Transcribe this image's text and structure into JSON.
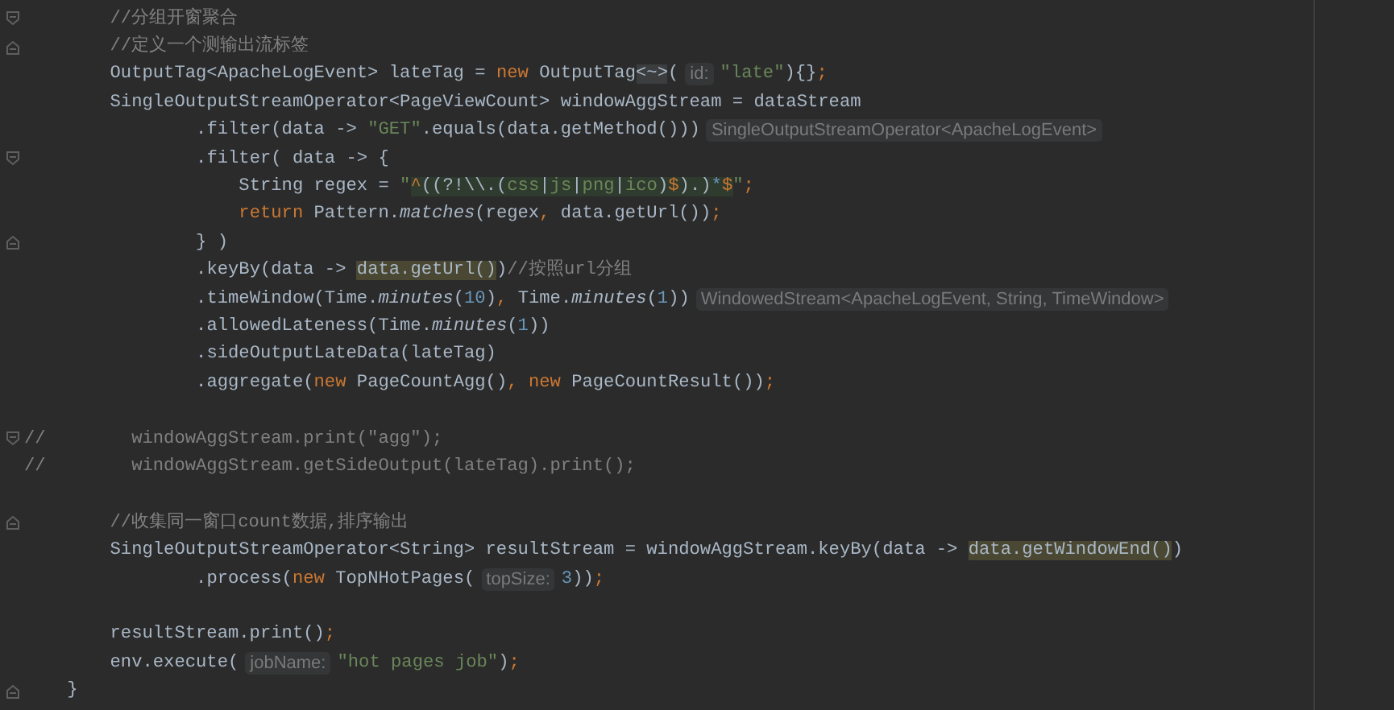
{
  "editor": {
    "lines": [
      {
        "kind": "opener",
        "tokens": [
          {
            "kind": "cmt",
            "text": "        //分组开窗聚合"
          }
        ]
      },
      {
        "kind": "closer",
        "tokens": [
          {
            "kind": "cmt",
            "text": "        //定义一个测输出流标签"
          }
        ]
      },
      {
        "kind": "code",
        "tokens": [
          {
            "kind": "plain",
            "text": "        OutputTag<ApacheLogEvent> lateTag = "
          },
          {
            "kind": "kw",
            "text": "new"
          },
          {
            "kind": "plain",
            "text": " OutputTag"
          },
          {
            "kind": "folded",
            "text": "<~>"
          },
          {
            "kind": "plain",
            "text": "("
          },
          {
            "kind": "hint",
            "text": "id:"
          },
          {
            "kind": "str",
            "text": "\"late\""
          },
          {
            "kind": "plain",
            "text": "){}"
          },
          {
            "kind": "kw",
            "text": ";"
          }
        ]
      },
      {
        "kind": "code",
        "tokens": [
          {
            "kind": "plain",
            "text": "        SingleOutputStreamOperator<PageViewCount> windowAggStream = dataStream"
          }
        ]
      },
      {
        "kind": "code",
        "tokens": [
          {
            "kind": "plain",
            "text": "                .filter(data -> "
          },
          {
            "kind": "str",
            "text": "\"GET\""
          },
          {
            "kind": "plain",
            "text": ".equals(data.getMethod()))"
          },
          {
            "kind": "hint",
            "text": "SingleOutputStreamOperator<ApacheLogEvent>"
          }
        ]
      },
      {
        "kind": "opener",
        "tokens": [
          {
            "kind": "plain",
            "text": "                .filter( data -> {"
          }
        ]
      },
      {
        "kind": "code",
        "tokens": [
          {
            "kind": "plain",
            "text": "                    String regex = "
          },
          {
            "kind": "str",
            "text": "\""
          },
          {
            "kind": "rx-op",
            "text": "^"
          },
          {
            "kind": "rx",
            "text": "((?!\\\\.("
          },
          {
            "kind": "rx-lit",
            "text": "css"
          },
          {
            "kind": "rx",
            "text": "|"
          },
          {
            "kind": "rx-lit",
            "text": "js"
          },
          {
            "kind": "rx",
            "text": "|"
          },
          {
            "kind": "rx-lit",
            "text": "png"
          },
          {
            "kind": "rx",
            "text": "|"
          },
          {
            "kind": "rx-lit",
            "text": "ico"
          },
          {
            "kind": "rx",
            "text": ")"
          },
          {
            "kind": "rx-op",
            "text": "$"
          },
          {
            "kind": "rx",
            "text": ").)"
          },
          {
            "kind": "rx-num",
            "text": "*"
          },
          {
            "kind": "rx-op",
            "text": "$"
          },
          {
            "kind": "str",
            "text": "\""
          },
          {
            "kind": "kw",
            "text": ";"
          }
        ]
      },
      {
        "kind": "code",
        "tokens": [
          {
            "kind": "kw",
            "text": "                    return"
          },
          {
            "kind": "plain",
            "text": " Pattern."
          },
          {
            "kind": "it",
            "text": "matches"
          },
          {
            "kind": "plain",
            "text": "(regex"
          },
          {
            "kind": "kw",
            "text": ","
          },
          {
            "kind": "plain",
            "text": " data.getUrl())"
          },
          {
            "kind": "kw",
            "text": ";"
          }
        ]
      },
      {
        "kind": "closer",
        "tokens": [
          {
            "kind": "plain",
            "text": "                } )"
          }
        ]
      },
      {
        "kind": "code",
        "tokens": [
          {
            "kind": "plain",
            "text": "                .keyBy(data -> "
          },
          {
            "kind": "hl",
            "text": "data.getUrl()"
          },
          {
            "kind": "plain",
            "text": ")"
          },
          {
            "kind": "cmt",
            "text": "//按照url分组"
          }
        ]
      },
      {
        "kind": "code",
        "tokens": [
          {
            "kind": "plain",
            "text": "                .timeWindow(Time."
          },
          {
            "kind": "it",
            "text": "minutes"
          },
          {
            "kind": "plain",
            "text": "("
          },
          {
            "kind": "num",
            "text": "10"
          },
          {
            "kind": "plain",
            "text": ")"
          },
          {
            "kind": "kw",
            "text": ","
          },
          {
            "kind": "plain",
            "text": " Time."
          },
          {
            "kind": "it",
            "text": "minutes"
          },
          {
            "kind": "plain",
            "text": "("
          },
          {
            "kind": "num",
            "text": "1"
          },
          {
            "kind": "plain",
            "text": "))"
          },
          {
            "kind": "hint",
            "text": "WindowedStream<ApacheLogEvent, String, TimeWindow>"
          }
        ]
      },
      {
        "kind": "code",
        "tokens": [
          {
            "kind": "plain",
            "text": "                .allowedLateness(Time."
          },
          {
            "kind": "it",
            "text": "minutes"
          },
          {
            "kind": "plain",
            "text": "("
          },
          {
            "kind": "num",
            "text": "1"
          },
          {
            "kind": "plain",
            "text": "))"
          }
        ]
      },
      {
        "kind": "code",
        "tokens": [
          {
            "kind": "plain",
            "text": "                .sideOutputLateData(lateTag)"
          }
        ]
      },
      {
        "kind": "code",
        "tokens": [
          {
            "kind": "plain",
            "text": "                .aggregate("
          },
          {
            "kind": "kw",
            "text": "new"
          },
          {
            "kind": "plain",
            "text": " PageCountAgg()"
          },
          {
            "kind": "kw",
            "text": ", new"
          },
          {
            "kind": "plain",
            "text": " PageCountResult())"
          },
          {
            "kind": "kw",
            "text": ";"
          }
        ]
      },
      {
        "kind": "blank"
      },
      {
        "kind": "opener",
        "tokens": [
          {
            "kind": "cmt",
            "text": "//        windowAggStream.print(\"agg\");"
          }
        ]
      },
      {
        "kind": "code",
        "tokens": [
          {
            "kind": "cmt",
            "text": "//        windowAggStream.getSideOutput(lateTag).print();"
          }
        ]
      },
      {
        "kind": "blank"
      },
      {
        "kind": "closer",
        "tokens": [
          {
            "kind": "cmt",
            "text": "        //收集同一窗口count数据,排序输出"
          }
        ]
      },
      {
        "kind": "code",
        "tokens": [
          {
            "kind": "plain",
            "text": "        SingleOutputStreamOperator<String> resultStream = windowAggStream.keyBy(data -> "
          },
          {
            "kind": "hl",
            "text": "data.getWindowEnd()"
          },
          {
            "kind": "plain",
            "text": ")"
          }
        ]
      },
      {
        "kind": "code",
        "tokens": [
          {
            "kind": "plain",
            "text": "                .process("
          },
          {
            "kind": "kw",
            "text": "new"
          },
          {
            "kind": "plain",
            "text": " TopNHotPages("
          },
          {
            "kind": "hint",
            "text": "topSize:"
          },
          {
            "kind": "num",
            "text": "3"
          },
          {
            "kind": "plain",
            "text": "))"
          },
          {
            "kind": "kw",
            "text": ";"
          }
        ]
      },
      {
        "kind": "blank"
      },
      {
        "kind": "code",
        "tokens": [
          {
            "kind": "plain",
            "text": "        resultStream.print()"
          },
          {
            "kind": "kw",
            "text": ";"
          }
        ]
      },
      {
        "kind": "code",
        "tokens": [
          {
            "kind": "plain",
            "text": "        env.execute("
          },
          {
            "kind": "hint",
            "text": "jobName:"
          },
          {
            "kind": "str",
            "text": "\"hot pages job\""
          },
          {
            "kind": "plain",
            "text": ")"
          },
          {
            "kind": "kw",
            "text": ";"
          }
        ]
      },
      {
        "kind": "closer",
        "tokens": [
          {
            "kind": "plain",
            "text": "    }"
          }
        ]
      }
    ]
  }
}
